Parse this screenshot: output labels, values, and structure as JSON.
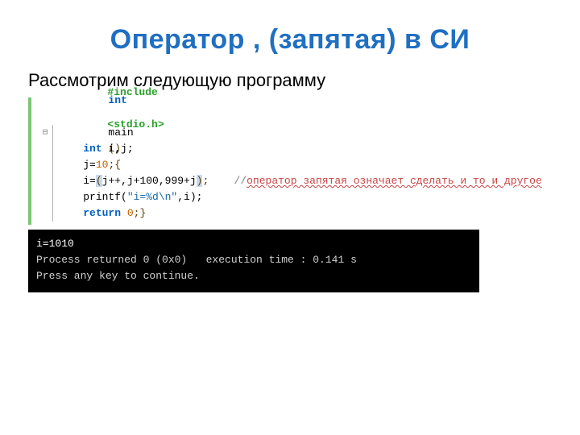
{
  "title": "Оператор , (запятая) в CИ",
  "intro": "Рассмотрим следующую программу",
  "code": {
    "include_pp": "#include",
    "include_hdr": "<stdio.h>",
    "main_kw1": "int",
    "main_id": "main",
    "main_paren": "()",
    "brace_open": " {",
    "decl_kw": "int",
    "decl_ids": " i,j;",
    "assign_j": "j=",
    "num10": "10",
    "semicolon": ";",
    "assign_i_lhs": "i=",
    "paren_open": "(",
    "expr_body": "j++,j+100,999+j",
    "paren_close": ")",
    "comment_marker": "//",
    "comment_text": "оператор запятая означает сделать и то и другое",
    "printf_id": "printf(",
    "printf_str": "\"i=%d\\n\"",
    "printf_tail": ",i);",
    "return_kw": "return",
    "return_val": " 0",
    "return_tail": ";}"
  },
  "console": {
    "l1": "i=1010",
    "l2": "",
    "l3": "Process returned 0 (0x0)   execution time : 0.141 s",
    "l4": "Press any key to continue."
  }
}
